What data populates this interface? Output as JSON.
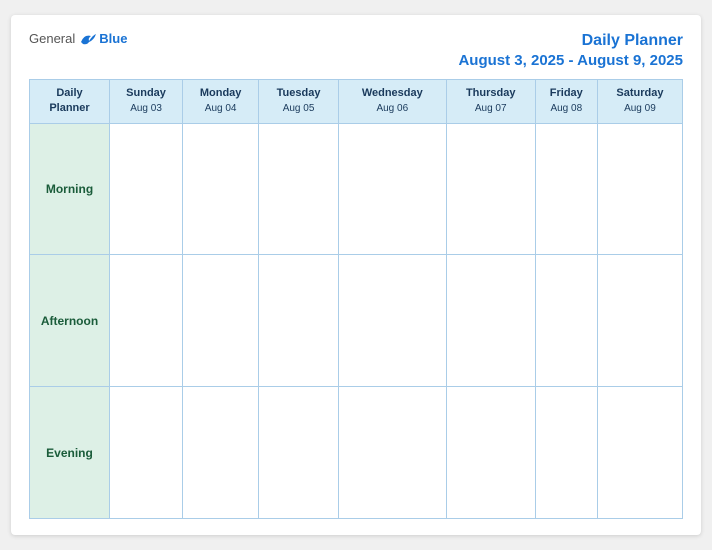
{
  "logo": {
    "general": "General",
    "blue": "Blue"
  },
  "header": {
    "title": "Daily Planner",
    "date_range": "August 3, 2025 - August 9, 2025"
  },
  "table": {
    "label_header_line1": "Daily",
    "label_header_line2": "Planner",
    "columns": [
      {
        "day": "Sunday",
        "date": "Aug 03"
      },
      {
        "day": "Monday",
        "date": "Aug 04"
      },
      {
        "day": "Tuesday",
        "date": "Aug 05"
      },
      {
        "day": "Wednesday",
        "date": "Aug 06"
      },
      {
        "day": "Thursday",
        "date": "Aug 07"
      },
      {
        "day": "Friday",
        "date": "Aug 08"
      },
      {
        "day": "Saturday",
        "date": "Aug 09"
      }
    ],
    "rows": [
      {
        "label": "Morning"
      },
      {
        "label": "Afternoon"
      },
      {
        "label": "Evening"
      }
    ]
  }
}
